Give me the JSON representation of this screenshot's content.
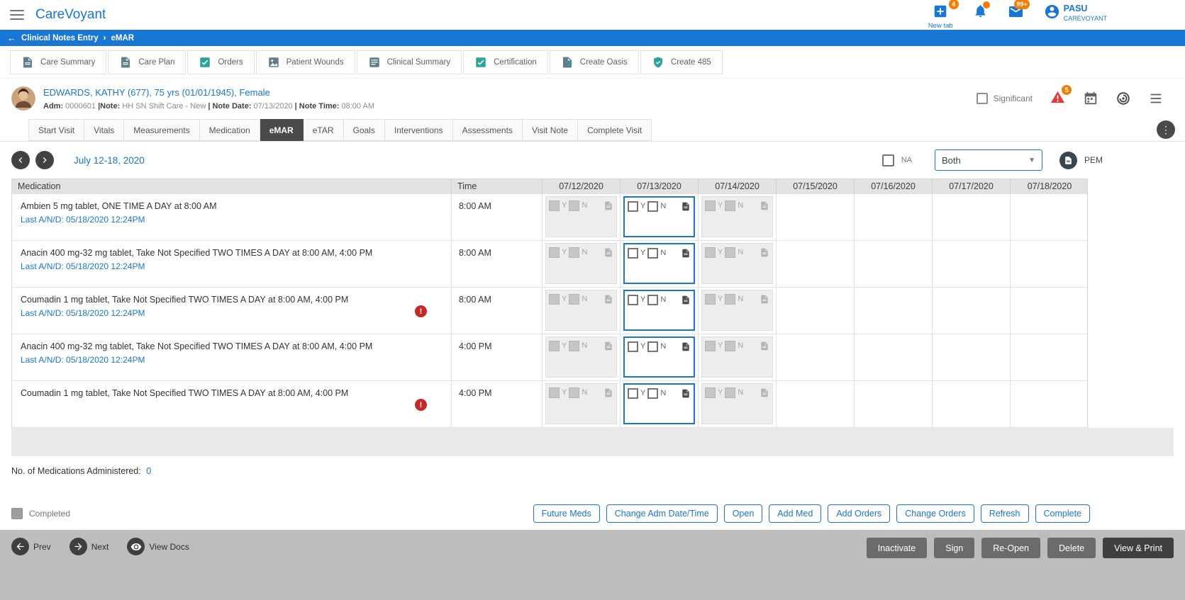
{
  "colors": {
    "primary": "#1976d2",
    "active_tab": "#4a4a4a",
    "alert_red": "#c62828",
    "badge_orange": "#f57c00",
    "teal_icon": "#26a69a",
    "bottombar_gray": "#bdbdbd"
  },
  "topbar": {
    "app_title": "CareVoyant",
    "new_tab": {
      "label": "New tab",
      "badge": "4"
    },
    "mail_badge": "99+",
    "user": {
      "name": "PASU",
      "org": "CAREVOYANT"
    }
  },
  "breadcrumb": {
    "back": "←",
    "section": "Clinical Notes Entry",
    "separator": "›",
    "current": "eMAR"
  },
  "toolbar": {
    "buttons": [
      {
        "label": "Care Summary",
        "icon": "document"
      },
      {
        "label": "Care Plan",
        "icon": "document"
      },
      {
        "label": "Orders",
        "icon": "check-square"
      },
      {
        "label": "Patient Wounds",
        "icon": "image"
      },
      {
        "label": "Clinical Summary",
        "icon": "list"
      },
      {
        "label": "Certification",
        "icon": "check-square"
      },
      {
        "label": "Create Oasis",
        "icon": "document-edit"
      },
      {
        "label": "Create 485",
        "icon": "shield-check"
      }
    ]
  },
  "patient": {
    "name_line": "EDWARDS, KATHY (677), 75 yrs (01/01/1945), Female",
    "details": [
      {
        "label": "Adm:",
        "value": "0000601"
      },
      {
        "label": "|Note:",
        "value": "HH SN Shift Care - New"
      },
      {
        "label": "| Note Date:",
        "value": "07/13/2020"
      },
      {
        "label": "| Note Time:",
        "value": "08:00 AM"
      }
    ],
    "significant_label": "Significant",
    "alert_badge": "5"
  },
  "tabs": {
    "items": [
      "Start Visit",
      "Vitals",
      "Measurements",
      "Medication",
      "eMAR",
      "eTAR",
      "Goals",
      "Interventions",
      "Assessments",
      "Visit Note",
      "Complete Visit"
    ],
    "active_index": 4
  },
  "controls": {
    "date_range": "July 12-18, 2020",
    "na_label": "NA",
    "filter_value": "Both",
    "pem_label": "PEM"
  },
  "table": {
    "columns": [
      "Medication",
      "Time",
      "07/12/2020",
      "07/13/2020",
      "07/14/2020",
      "07/15/2020",
      "07/16/2020",
      "07/17/2020",
      "07/18/2020"
    ],
    "day_states": [
      "disabled",
      "active",
      "disabled",
      "blank",
      "blank",
      "blank",
      "blank"
    ],
    "yes_label": "Y",
    "no_label": "N",
    "rows": [
      {
        "medication": "Ambien 5 mg tablet, ONE TIME A DAY at 8:00 AM",
        "last_and": "Last A/N/D: 05/18/2020 12:24PM",
        "time": "8:00 AM",
        "alert": false
      },
      {
        "medication": "Anacin 400 mg-32 mg tablet, Take Not Specified TWO TIMES A DAY at 8:00 AM, 4:00 PM",
        "last_and": "Last A/N/D: 05/18/2020 12:24PM",
        "time": "8:00 AM",
        "alert": false
      },
      {
        "medication": "Coumadin 1 mg tablet, Take Not Specified TWO TIMES A DAY at 8:00 AM, 4:00 PM",
        "last_and": "Last A/N/D: 05/18/2020 12:24PM",
        "time": "8:00 AM",
        "alert": true
      },
      {
        "medication": "Anacin 400 mg-32 mg tablet, Take Not Specified TWO TIMES A DAY at 8:00 AM, 4:00 PM",
        "last_and": "Last A/N/D: 05/18/2020 12:24PM",
        "time": "4:00 PM",
        "alert": false
      },
      {
        "medication": "Coumadin 1 mg tablet, Take Not Specified TWO TIMES A DAY at 8:00 AM, 4:00 PM",
        "last_and": "",
        "time": "4:00 PM",
        "alert": true
      }
    ]
  },
  "summary": {
    "label": "No. of Medications Administered:",
    "value": "0"
  },
  "actions": {
    "completed_label": "Completed",
    "buttons": [
      "Future Meds",
      "Change Adm Date/Time",
      "Open",
      "Add Med",
      "Add Orders",
      "Change Orders",
      "Refresh",
      "Complete"
    ]
  },
  "bottombar": {
    "nav": [
      {
        "label": "Prev",
        "icon": "arrow-left"
      },
      {
        "label": "Next",
        "icon": "arrow-right"
      },
      {
        "label": "View Docs",
        "icon": "eye"
      }
    ],
    "buttons": [
      {
        "label": "Inactivate",
        "primary": false
      },
      {
        "label": "Sign",
        "primary": false
      },
      {
        "label": "Re-Open",
        "primary": false
      },
      {
        "label": "Delete",
        "primary": false
      },
      {
        "label": "View & Print",
        "primary": true
      }
    ]
  }
}
